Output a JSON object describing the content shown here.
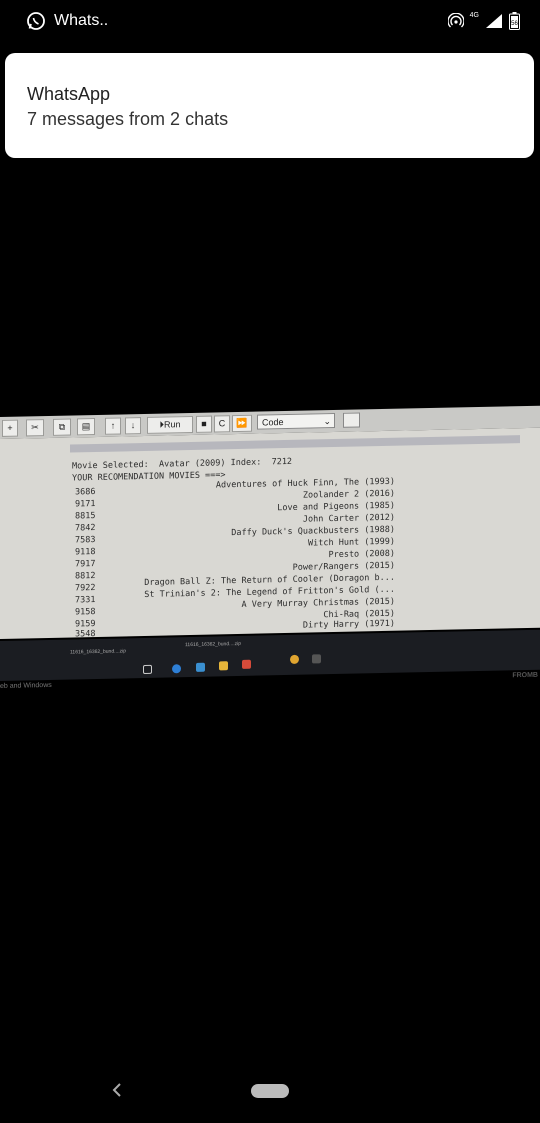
{
  "status_bar": {
    "title": "Whats..",
    "network": "4G",
    "battery_icon": "battery-icon"
  },
  "notification": {
    "app_name": "WhatsApp",
    "text": "7 messages from 2 chats"
  },
  "notebook": {
    "toolbar": {
      "run_label": "Run",
      "cell_type": "Code"
    },
    "output_header": "Movie Selected:  Avatar (2009) Index:  7212",
    "output_subheader": "YOUR RECOMENDATION MOVIES ===>",
    "rows": [
      {
        "index": "3686",
        "title": "Adventures of Huck Finn, The (1993)"
      },
      {
        "index": "9171",
        "title": "Zoolander 2 (2016)"
      },
      {
        "index": "8815",
        "title": "Love and Pigeons (1985)"
      },
      {
        "index": "7842",
        "title": "John Carter (2012)"
      },
      {
        "index": "7583",
        "title": "Daffy Duck's Quackbusters (1988)"
      },
      {
        "index": "9118",
        "title": "Witch Hunt (1999)"
      },
      {
        "index": "7917",
        "title": "Presto (2008)"
      },
      {
        "index": "8812",
        "title": "Power/Rangers (2015)"
      },
      {
        "index": "7922",
        "title": "Dragon Ball Z: The Return of Cooler (Doragon b..."
      },
      {
        "index": "7331",
        "title": "St Trinian's 2: The Legend of Fritton's Gold (..."
      },
      {
        "index": "9158",
        "title": "A Very Murray Christmas (2015)"
      },
      {
        "index": "9159",
        "title": "Chi-Raq (2015)"
      },
      {
        "index": "3548",
        "title": "Dirty Harry (1971)"
      }
    ],
    "downloads": [
      "11616_16362_bund....zip",
      "11616_16362_bund....zip"
    ],
    "taskbar_left": "eb and Windows",
    "taskbar_brand": "FROMB"
  },
  "colors": {
    "notification_bg": "#ffffff",
    "page_bg": "#000000"
  }
}
